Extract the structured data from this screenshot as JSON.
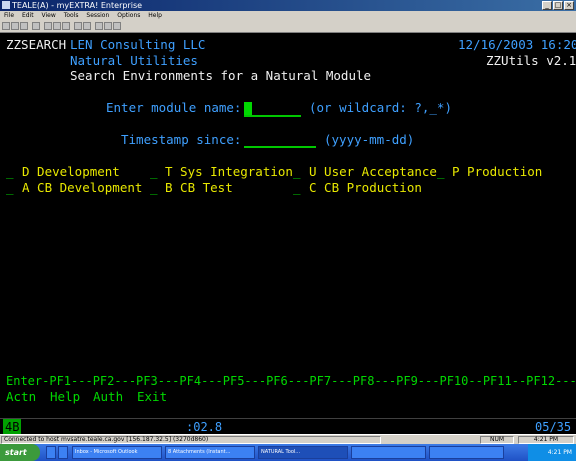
{
  "window": {
    "title": "TEALE(A) - myEXTRA! Enterprise"
  },
  "menu": [
    "File",
    "Edit",
    "View",
    "Tools",
    "Session",
    "Options",
    "Help"
  ],
  "screen": {
    "program": "ZZSEARCH",
    "company": "LEN Consulting LLC",
    "datetime": "12/16/2003 16:20",
    "subtitle": "Natural Utilities",
    "product": "ZZUtils v2.1",
    "heading": "Search Environments for a Natural Module",
    "module_label": "Enter module name:",
    "module_hint": "(or wildcard: ?,_*)",
    "timestamp_label": "Timestamp since:",
    "timestamp_hint": "(yyyy-mm-dd)",
    "env_row1": [
      {
        "sel": "_",
        "label": "D Development"
      },
      {
        "sel": "_",
        "label": "T Sys Integration"
      },
      {
        "sel": "_",
        "label": "U User Acceptance"
      },
      {
        "sel": "_",
        "label": "P Production"
      }
    ],
    "env_row2": [
      {
        "sel": "_",
        "label": "A CB Development"
      },
      {
        "sel": "_",
        "label": "B CB Test"
      },
      {
        "sel": "_",
        "label": "C CB Production"
      }
    ],
    "pf_line": "Enter-PF1---PF2---PF3---PF4---PF5---PF6---PF7---PF8---PF9---PF10--PF11--PF12---",
    "pf_labels": {
      "enter": "Actn",
      "pf1": "Help",
      "pf2": "Auth",
      "pf3": "Exit"
    }
  },
  "status": {
    "session": "4B",
    "elapsed": ":02.8",
    "cursor": "05/35"
  },
  "infobar": {
    "connection": "Connected to host mvsatre.teale.ca.gov [156.187.32.5] (3270d860)",
    "mode": "NUM",
    "clock": "4:21 PM"
  },
  "taskbar": {
    "start": "start",
    "tasks": [
      "Inbox - Microsoft Outlook",
      "8 Attachments (Instant...",
      "NATURAL Tool..."
    ],
    "time": "4:21 PM"
  },
  "colors": {
    "field": "#00d800",
    "protected": "#3fa0ff",
    "highlight": "#e8e800",
    "background": "#000000"
  }
}
